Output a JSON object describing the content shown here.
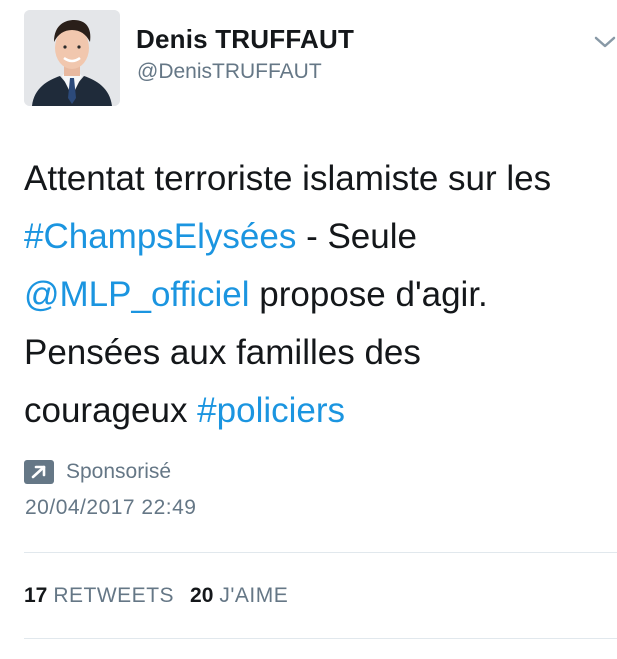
{
  "author": {
    "name": "Denis TRUFFAUT",
    "handle": "@DenisTRUFFAUT",
    "avatar_icon": "profile-photo"
  },
  "tweet": {
    "lines": [
      [
        {
          "text": "Attentat terroriste islamiste sur les",
          "type": "text"
        }
      ],
      [
        {
          "text": "#ChampsElysées",
          "type": "hashtag"
        },
        {
          "text": " - Seule",
          "type": "text"
        }
      ],
      [
        {
          "text": "@MLP_officiel",
          "type": "mention"
        },
        {
          "text": " propose d'agir.",
          "type": "text"
        }
      ],
      [
        {
          "text": "Pensées aux familles des",
          "type": "text"
        }
      ],
      [
        {
          "text": "courageux ",
          "type": "text"
        },
        {
          "text": "#policiers",
          "type": "hashtag"
        }
      ]
    ]
  },
  "meta": {
    "sponsored_label": "Sponsorisé",
    "sponsored_icon": "promoted-arrow-icon",
    "timestamp": "20/04/2017 22:49"
  },
  "stats": {
    "retweets_count": "17",
    "retweets_label": "RETWEETS",
    "likes_count": "20",
    "likes_label": "J'AIME"
  },
  "colors": {
    "link": "#1b95e0",
    "secondary_text": "#657786",
    "primary_text": "#14171a",
    "divider": "#e1e8ed"
  },
  "icons": {
    "menu": "chevron-down-icon"
  }
}
